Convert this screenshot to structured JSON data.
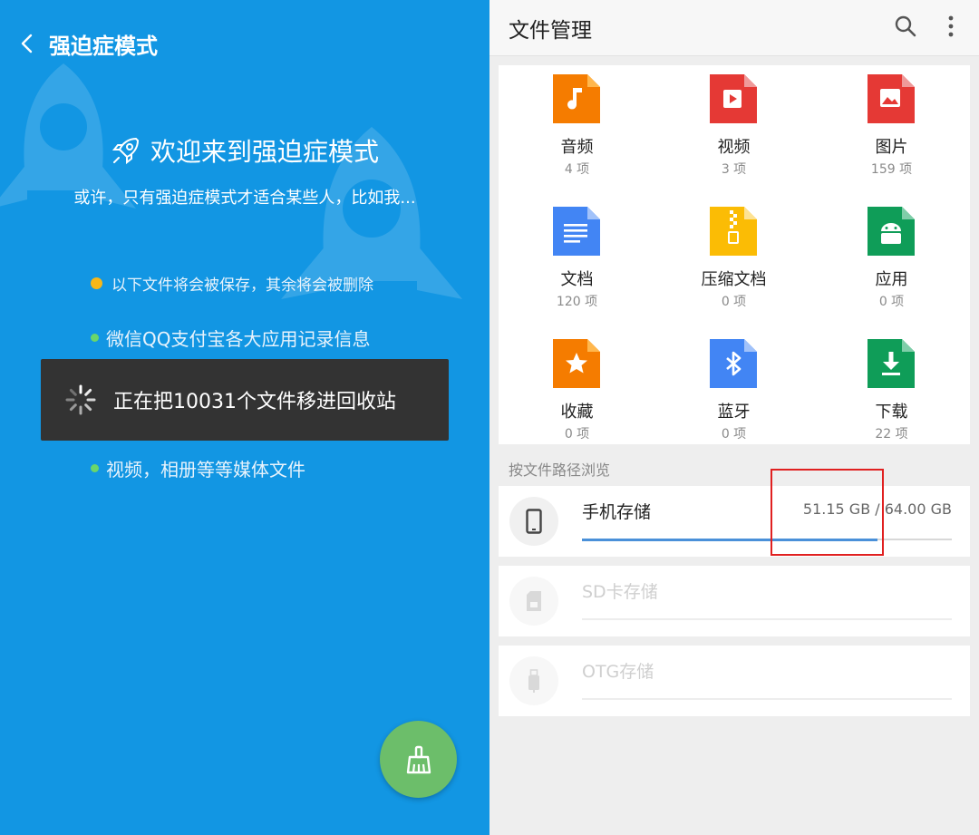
{
  "left": {
    "title": "强迫症模式",
    "welcome": "欢迎来到强迫症模式",
    "subtitle": "或许，只有强迫症模式才适合某些人，比如我...",
    "bullets": [
      "以下文件将会被保存，其余将会被删除",
      "微信QQ支付宝各大应用记录信息",
      "视频，相册等等媒体文件"
    ],
    "toast": "正在把10031个文件移进回收站",
    "colors": {
      "background": "#1296e3",
      "toast": "#333333",
      "fab": "#6cbe6a",
      "bullet_primary": "#f7b718",
      "bullet_secondary": "#6ad66a"
    }
  },
  "right": {
    "title": "文件管理",
    "categories": [
      {
        "name": "音频",
        "count": "4 项",
        "icon": "music-note-icon",
        "color": "#f57c00"
      },
      {
        "name": "视频",
        "count": "3 项",
        "icon": "video-play-icon",
        "color": "#e53935"
      },
      {
        "name": "图片",
        "count": "159 项",
        "icon": "image-icon",
        "color": "#e53935"
      },
      {
        "name": "文档",
        "count": "120 项",
        "icon": "document-icon",
        "color": "#4285f4"
      },
      {
        "name": "压缩文档",
        "count": "0 项",
        "icon": "zip-icon",
        "color": "#fbbc05"
      },
      {
        "name": "应用",
        "count": "0 项",
        "icon": "android-icon",
        "color": "#0f9d58"
      },
      {
        "name": "收藏",
        "count": "0 项",
        "icon": "star-icon",
        "color": "#f57c00"
      },
      {
        "name": "蓝牙",
        "count": "0 项",
        "icon": "bluetooth-icon",
        "color": "#4285f4"
      },
      {
        "name": "下载",
        "count": "22 项",
        "icon": "download-icon",
        "color": "#0f9d58"
      }
    ],
    "browse_label": "按文件路径浏览",
    "storage": [
      {
        "name": "手机存储",
        "size": "51.15 GB / 64.00 GB",
        "used_fraction": 0.799,
        "enabled": true
      },
      {
        "name": "SD卡存储",
        "size": "",
        "used_fraction": 0,
        "enabled": false
      },
      {
        "name": "OTG存储",
        "size": "",
        "used_fraction": 0,
        "enabled": false
      }
    ]
  }
}
